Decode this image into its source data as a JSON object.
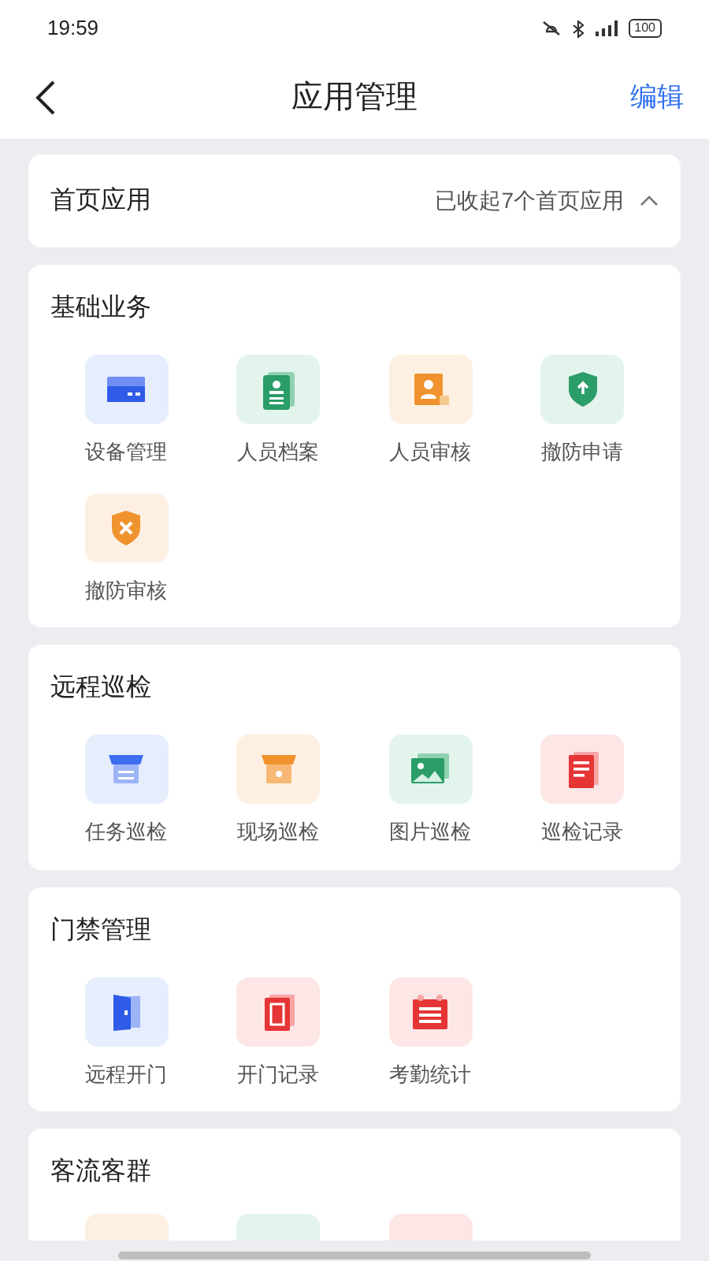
{
  "status_bar": {
    "time": "19:59",
    "battery": "100"
  },
  "header": {
    "title": "应用管理",
    "action": "编辑"
  },
  "home_section": {
    "title": "首页应用",
    "summary": "已收起7个首页应用",
    "expanded": false
  },
  "sections": [
    {
      "title": "基础业务",
      "items": [
        {
          "label": "设备管理"
        },
        {
          "label": "人员档案"
        },
        {
          "label": "人员审核"
        },
        {
          "label": "撤防申请"
        },
        {
          "label": "撤防审核"
        }
      ]
    },
    {
      "title": "远程巡检",
      "items": [
        {
          "label": "任务巡检"
        },
        {
          "label": "现场巡检"
        },
        {
          "label": "图片巡检"
        },
        {
          "label": "巡检记录"
        }
      ]
    },
    {
      "title": "门禁管理",
      "items": [
        {
          "label": "远程开门"
        },
        {
          "label": "开门记录"
        },
        {
          "label": "考勤统计"
        }
      ]
    },
    {
      "title": "客流客群"
    }
  ]
}
